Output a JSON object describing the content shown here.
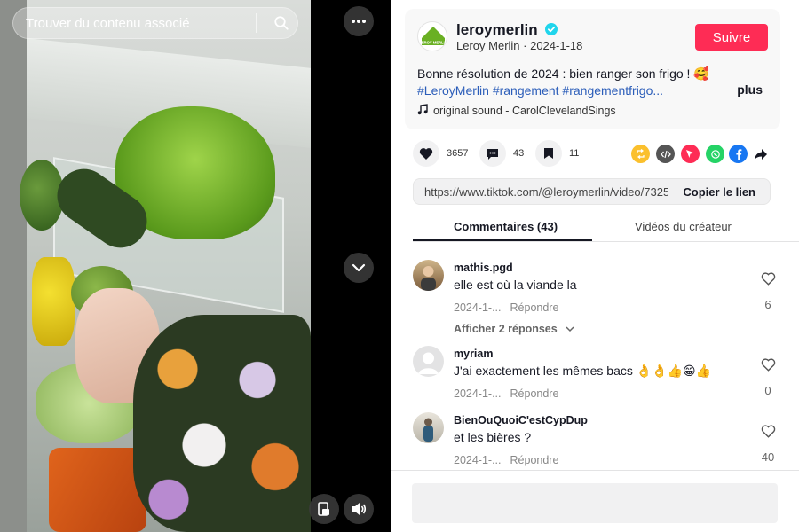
{
  "search": {
    "placeholder": "Trouver du contenu associé"
  },
  "author": {
    "handle": "leroymerlin",
    "display_name": "Leroy Merlin",
    "date": "2024-1-18",
    "logo_text": "LEROY MERLIN",
    "follow_label": "Suivre"
  },
  "description": {
    "text": "Bonne résolution de 2024 : bien ranger son frigo ! 🥰",
    "tags": "#LeroyMerlin #rangement #rangementfrigo...",
    "more_label": "plus"
  },
  "music": {
    "label": "original sound - CarolClevelandSings"
  },
  "stats": {
    "likes": "3657",
    "comments": "43",
    "saves": "11"
  },
  "link": {
    "url": "https://www.tiktok.com/@leroymerlin/video/7325...",
    "copy_label": "Copier le lien"
  },
  "tabs": {
    "comments": "Commentaires (43)",
    "creator_videos": "Vidéos du créateur"
  },
  "comments": [
    {
      "user": "mathis.pgd",
      "text": "elle est où la viande la",
      "date": "2024-1-...",
      "reply": "Répondre",
      "likes": "6",
      "replies_label": "Afficher 2 réponses"
    },
    {
      "user": "myriam",
      "text": "J'ai exactement les mêmes bacs 👌👌👍😁👍",
      "date": "2024-1-...",
      "reply": "Répondre",
      "likes": "0"
    },
    {
      "user": "BienOuQuoiC'estCypDup",
      "text": "et les bières ?",
      "date": "2024-1-...",
      "reply": "Répondre",
      "likes": "40"
    }
  ],
  "colors": {
    "accent": "#fe2c55",
    "hashtag": "#2b5db9",
    "brand_green": "#6ab023"
  },
  "icons": [
    "search-icon",
    "more-icon",
    "chevron-down-icon",
    "picture-in-picture-icon",
    "volume-icon",
    "verified-icon",
    "music-note-icon",
    "heart-icon",
    "comment-icon",
    "bookmark-icon",
    "share-icons",
    "share-arrow-icon"
  ]
}
